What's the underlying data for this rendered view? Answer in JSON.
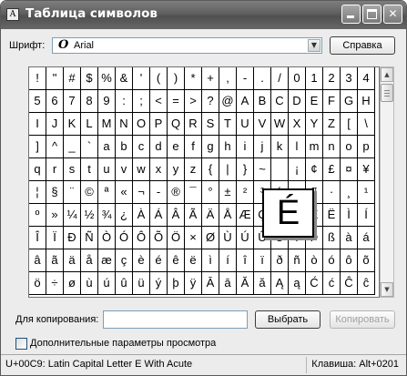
{
  "window": {
    "title": "Таблица символов",
    "icon_glyph": "A",
    "buttons": [
      "minimize",
      "maximize",
      "close"
    ]
  },
  "font_row": {
    "label": "Шрифт:",
    "selected_font": "Arial",
    "font_icon_glyph": "O",
    "help_button": "Справка"
  },
  "grid": {
    "rows": [
      [
        "!",
        "\"",
        "#",
        "$",
        "%",
        "&",
        "'",
        "(",
        ")",
        "*",
        "+",
        ",",
        "-",
        ".",
        "/",
        "0",
        "1",
        "2",
        "3",
        "4"
      ],
      [
        "5",
        "6",
        "7",
        "8",
        "9",
        ":",
        ";",
        "<",
        "=",
        ">",
        "?",
        "@",
        "A",
        "B",
        "C",
        "D",
        "E",
        "F",
        "G",
        "H"
      ],
      [
        "I",
        "J",
        "K",
        "L",
        "M",
        "N",
        "O",
        "P",
        "Q",
        "R",
        "S",
        "T",
        "U",
        "V",
        "W",
        "X",
        "Y",
        "Z",
        "[",
        "\\"
      ],
      [
        "]",
        "^",
        "_",
        "`",
        "a",
        "b",
        "c",
        "d",
        "e",
        "f",
        "g",
        "h",
        "i",
        "j",
        "k",
        "l",
        "m",
        "n",
        "o",
        "p"
      ],
      [
        "q",
        "r",
        "s",
        "t",
        "u",
        "v",
        "w",
        "x",
        "y",
        "z",
        "{",
        "|",
        "}",
        "~",
        " ",
        "¡",
        "¢",
        "£",
        "¤",
        "¥"
      ],
      [
        "¦",
        "§",
        "¨",
        "©",
        "ª",
        "«",
        "¬",
        "-",
        "®",
        "¯",
        "°",
        "±",
        "²",
        "³",
        "´",
        "µ",
        "¶",
        "·",
        "¸",
        "¹"
      ],
      [
        "º",
        "»",
        "¼",
        "½",
        "¾",
        "¿",
        "À",
        "Á",
        "Â",
        "Ã",
        "Ä",
        "Å",
        "Æ",
        "Ç",
        "È",
        "É",
        "Ê",
        "Ë",
        "Ì",
        "Í"
      ],
      [
        "Î",
        "Ï",
        "Ð",
        "Ñ",
        "Ò",
        "Ó",
        "Ô",
        "Õ",
        "Ö",
        "×",
        "Ø",
        "Ù",
        "Ú",
        "Û",
        "Ü",
        "Ý",
        "Þ",
        "ß",
        "à",
        "á"
      ],
      [
        "â",
        "ã",
        "ä",
        "å",
        "æ",
        "ç",
        "è",
        "é",
        "ê",
        "ë",
        "ì",
        "í",
        "î",
        "ï",
        "ð",
        "ñ",
        "ò",
        "ó",
        "ô",
        "õ"
      ],
      [
        "ö",
        "÷",
        "ø",
        "ù",
        "ú",
        "û",
        "ü",
        "ý",
        "þ",
        "ÿ",
        "Ā",
        "ā",
        "Ă",
        "ă",
        "Ą",
        "ą",
        "Ć",
        "ć",
        "Ĉ",
        "ĉ"
      ]
    ],
    "magnified_char": "É"
  },
  "copy_row": {
    "label": "Для копирования:",
    "value": "",
    "select_button": "Выбрать",
    "copy_button": "Копировать"
  },
  "advanced": {
    "label": "Дополнительные параметры просмотра",
    "checked": false
  },
  "status": {
    "char_info": "U+00C9: Latin Capital Letter E With Acute",
    "keystroke": "Клавиша: Alt+0201"
  }
}
